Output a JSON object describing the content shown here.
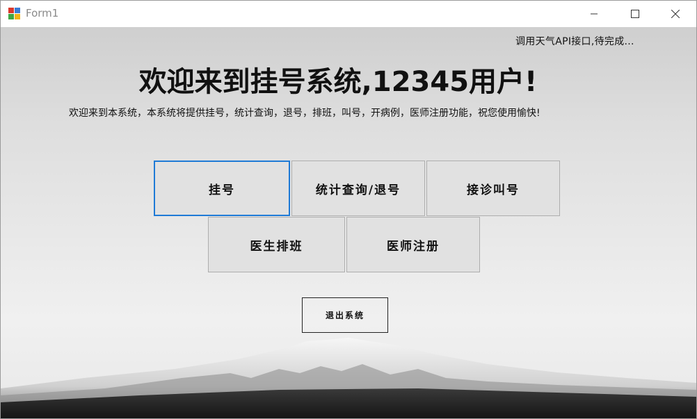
{
  "window": {
    "title": "Form1",
    "controls": {
      "minimize": "minimize-icon",
      "maximize": "maximize-icon",
      "close": "close-icon"
    }
  },
  "header": {
    "weather_text": "调用天气API接口,待完成...",
    "welcome_title": "欢迎来到挂号系统,12345用户!",
    "intro_text": "欢迎来到本系统，本系统将提供挂号，统计查询，退号，排班，叫号，开病例，医师注册功能，祝您使用愉快!"
  },
  "menu": {
    "register": "挂号",
    "stats_refund": "统计查询/退号",
    "reception_call": "接诊叫号",
    "doctor_schedule": "医生排班",
    "doctor_register": "医师注册"
  },
  "footer": {
    "exit": "退出系统"
  },
  "colors": {
    "focus_border": "#1e7ad6",
    "button_bg": "#e1e1e1",
    "button_border": "#adadad"
  }
}
